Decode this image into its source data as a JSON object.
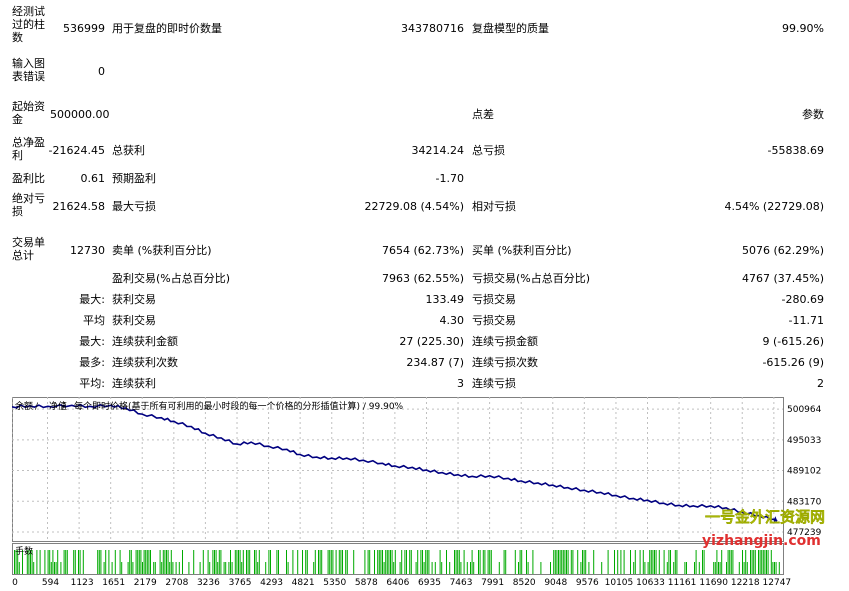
{
  "report": {
    "bars_label": "经测试过的柱数",
    "bars_value": "536999",
    "ticks_label": "用于复盘的即时价数量",
    "ticks_value": "343780716",
    "quality_label": "复盘模型的质量",
    "quality_value": "99.90%",
    "errors_label": "输入图表错误",
    "errors_value": "0",
    "deposit_label": "起始资金",
    "deposit_value": "500000.00",
    "spread_label": "点差",
    "params_label": "参数",
    "net_label": "总净盈利",
    "net_value": "-21624.45",
    "gross_profit_label": "总获利",
    "gross_profit_value": "34214.24",
    "gross_loss_label": "总亏损",
    "gross_loss_value": "-55838.69",
    "pf_label": "盈利比",
    "pf_value": "0.61",
    "expected_label": "预期盈利",
    "expected_value": "-1.70",
    "abs_dd_label": "绝对亏损",
    "abs_dd_value": "21624.58",
    "max_dd_label": "最大亏损",
    "max_dd_value": "22729.08 (4.54%)",
    "rel_dd_label": "相对亏损",
    "rel_dd_value": "4.54% (22729.08)",
    "total_trades_label": "交易单总计",
    "total_trades_value": "12730",
    "short_label": "卖单 (%获利百分比)",
    "short_value": "7654 (62.73%)",
    "long_label": "买单 (%获利百分比)",
    "long_value": "5076 (62.29%)",
    "profit_trades_label": "盈利交易(%占总百分比)",
    "profit_trades_value": "7963 (62.55%)",
    "loss_trades_label": "亏损交易(%占总百分比)",
    "loss_trades_value": "4767 (37.45%)",
    "largest_prefix": "最大:",
    "largest_profit_label": "获利交易",
    "largest_profit_value": "133.49",
    "largest_loss_label": "亏损交易",
    "largest_loss_value": "-280.69",
    "average_prefix": "平均",
    "average_profit_label": "获利交易",
    "average_profit_value": "4.30",
    "average_loss_label": "亏损交易",
    "average_loss_value": "-11.71",
    "max_consec_prefix": "最大:",
    "max_consec_wins_label": "连续获利金额",
    "max_consec_wins_value": "27 (225.30)",
    "max_consec_losses_label": "连续亏损金额",
    "max_consec_losses_value": "9 (-615.26)",
    "most_prefix": "最多:",
    "most_consec_profit_label": "连续获利次数",
    "most_consec_profit_value": "234.87 (7)",
    "most_consec_loss_label": "连续亏损次数",
    "most_consec_loss_value": "-615.26 (9)",
    "avg_consec_prefix": "平均:",
    "avg_consec_wins_label": "连续获利",
    "avg_consec_wins_value": "3",
    "avg_consec_losses_label": "连续亏损",
    "avg_consec_losses_value": "2"
  },
  "chart": {
    "legend_balance": "余额",
    "legend_sep1": " / ",
    "legend_equity": "净值",
    "legend_sep2": " / ",
    "legend_text": "每个即时价格(基于所有可利用的最小时段的每一个价格的分形插值计算) / 99.90%",
    "lots_label": "手数",
    "watermark_cn": "一号金外汇资源网",
    "watermark_url": "yizhangjin.com",
    "colors": {
      "line": "#000080",
      "lots": "#00aa00",
      "grid": "#c0c0c0"
    }
  },
  "chart_data": {
    "type": "line",
    "title": "",
    "xlabel": "",
    "ylabel": "",
    "x_ticks": [
      "0",
      "594",
      "1123",
      "1651",
      "2179",
      "2708",
      "3236",
      "3765",
      "4293",
      "4821",
      "5350",
      "5878",
      "6406",
      "6935",
      "7463",
      "7991",
      "8520",
      "9048",
      "9576",
      "10105",
      "10633",
      "11161",
      "11690",
      "12218",
      "12747"
    ],
    "y_ticks": [
      "500964",
      "495033",
      "489102",
      "483170",
      "477239"
    ],
    "xlim": [
      0,
      12900
    ],
    "ylim": [
      475500,
      503300
    ],
    "series": [
      {
        "x": [
          0,
          300,
          600,
          1000,
          1300,
          1651,
          1900,
          2179,
          2500,
          2708,
          3000,
          3236,
          3500,
          3765,
          4000,
          4293,
          4600,
          4821,
          5100,
          5350,
          5600,
          5878,
          6200,
          6406,
          6700,
          6935,
          7200,
          7463,
          7700,
          7991,
          8300,
          8520,
          8800,
          9048,
          9300,
          9576,
          9850,
          10105,
          10400,
          10633,
          10900,
          11161,
          11400,
          11690,
          11950,
          12218,
          12500,
          12747,
          12800
        ],
        "y": [
          501400,
          501600,
          501500,
          501700,
          501500,
          501700,
          501200,
          500000,
          499300,
          498600,
          497600,
          496300,
          495400,
          494200,
          494600,
          493800,
          493200,
          492200,
          491700,
          491500,
          491500,
          491100,
          490500,
          490000,
          489700,
          489200,
          488700,
          488300,
          488000,
          488100,
          487600,
          487100,
          486700,
          486300,
          485800,
          485300,
          484900,
          484300,
          483700,
          483400,
          482800,
          482400,
          482300,
          482300,
          481900,
          481100,
          480400,
          479700,
          479600
        ]
      }
    ]
  }
}
